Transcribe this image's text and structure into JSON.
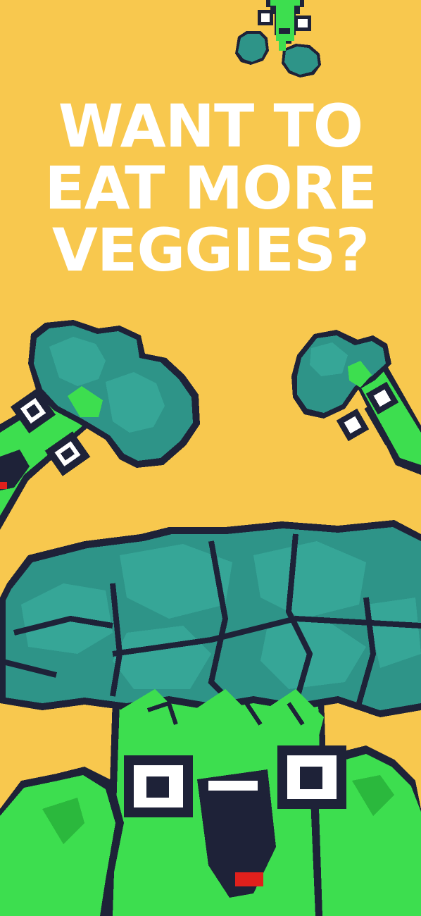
{
  "headline": {
    "line1": "WANT TO",
    "line2": "EAT MORE",
    "line3": "VEGGIES?"
  },
  "colors": {
    "background": "#f8c84e",
    "broccoli_head": "#2e9488",
    "broccoli_head_light": "#36a697",
    "broccoli_stem": "#3dde4f",
    "outline": "#1e2238",
    "eye_white": "#ffffff",
    "tongue": "#e0201c",
    "text": "#ffffff"
  },
  "illustrations": {
    "top": "small-falling-broccoli-character",
    "left": "broccoli-character-left",
    "right": "broccoli-character-right",
    "main": "large-broccoli-character-flexing"
  }
}
